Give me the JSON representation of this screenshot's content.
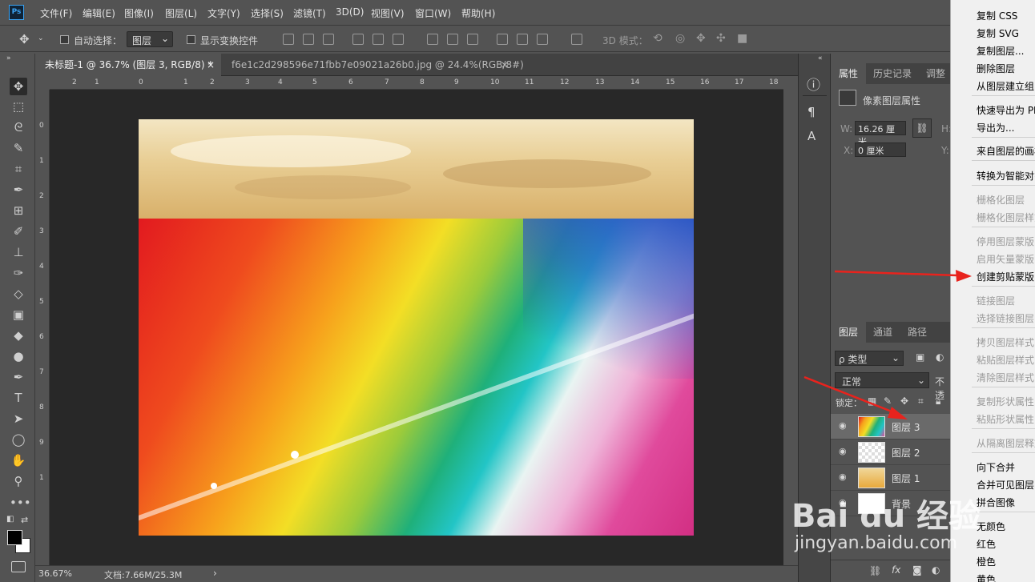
{
  "app": {
    "logo": "Ps"
  },
  "menu": [
    "文件(F)",
    "编辑(E)",
    "图像(I)",
    "图层(L)",
    "文字(Y)",
    "选择(S)",
    "滤镜(T)",
    "3D(D)",
    "视图(V)",
    "窗口(W)",
    "帮助(H)"
  ],
  "options": {
    "auto_select_label": "自动选择：",
    "auto_select_value": "图层",
    "show_transform_label": "显示变换控件",
    "mode3d_label": "3D 模式："
  },
  "tabs": [
    {
      "label": "未标题-1 @ 36.7% (图层 3, RGB/8) *",
      "close": "×"
    },
    {
      "label": "f6e1c2d298596e71fbb7e09021a26b0.jpg @ 24.4%(RGB/8#)",
      "close": "×"
    }
  ],
  "ruler_top": [
    "2",
    "1",
    "0",
    "1",
    "2",
    "3",
    "4",
    "5",
    "6",
    "7",
    "8",
    "9",
    "10",
    "11",
    "12",
    "13",
    "14",
    "15",
    "16",
    "17",
    "18"
  ],
  "ruler_left": [
    "0",
    "1",
    "2",
    "3",
    "4",
    "5",
    "6",
    "7",
    "8",
    "9",
    "1"
  ],
  "status": {
    "zoom": "36.67%",
    "doc": "文档:7.66M/25.3M",
    "arrow": "›"
  },
  "properties": {
    "tabs": [
      "属性",
      "历史记录",
      "调整"
    ],
    "title": "像素图层属性",
    "w_label": "W:",
    "w_value": "16.26 厘米",
    "h_label": "H:",
    "x_label": "X:",
    "x_value": "0 厘米",
    "y_label": "Y:"
  },
  "layers_panel": {
    "tabs": [
      "图层",
      "通道",
      "路径"
    ],
    "filter_label": "ρ 类型",
    "blend_mode": "正常",
    "opacity_label": "不透",
    "lock_label": "锁定：",
    "layers": [
      {
        "name": "图层 3"
      },
      {
        "name": "图层 2"
      },
      {
        "name": "图层 1"
      },
      {
        "name": "背景"
      }
    ],
    "fx_label": "fx"
  },
  "context_menu": [
    {
      "label": "复制 CSS",
      "enabled": true
    },
    {
      "label": "复制 SVG",
      "enabled": true
    },
    {
      "label": "复制图层...",
      "enabled": true
    },
    {
      "label": "删除图层",
      "enabled": true
    },
    {
      "label": "从图层建立组...",
      "enabled": true
    },
    {
      "label": "快速导出为 PNG",
      "enabled": true
    },
    {
      "label": "导出为...",
      "enabled": true
    },
    {
      "label": "来自图层的画板...",
      "enabled": true
    },
    {
      "label": "转换为智能对象",
      "enabled": true
    },
    {
      "label": "栅格化图层",
      "enabled": false
    },
    {
      "label": "栅格化图层样式",
      "enabled": false
    },
    {
      "label": "停用图层蒙版",
      "enabled": false
    },
    {
      "label": "启用矢量蒙版",
      "enabled": false
    },
    {
      "label": "创建剪贴蒙版",
      "enabled": true
    },
    {
      "label": "链接图层",
      "enabled": false
    },
    {
      "label": "选择链接图层",
      "enabled": false
    },
    {
      "label": "拷贝图层样式",
      "enabled": false
    },
    {
      "label": "粘贴图层样式",
      "enabled": false
    },
    {
      "label": "清除图层样式",
      "enabled": false
    },
    {
      "label": "复制形状属性",
      "enabled": false
    },
    {
      "label": "粘贴形状属性",
      "enabled": false
    },
    {
      "label": "从隔离图层释放",
      "enabled": false
    },
    {
      "label": "向下合并",
      "enabled": true
    },
    {
      "label": "合并可见图层",
      "enabled": true
    },
    {
      "label": "拼合图像",
      "enabled": true
    },
    {
      "label": "无颜色",
      "enabled": true
    },
    {
      "label": "红色",
      "enabled": true
    },
    {
      "label": "橙色",
      "enabled": true
    },
    {
      "label": "黄色",
      "enabled": true
    }
  ],
  "watermark": {
    "brand": "Bai du 经验",
    "url": "jingyan.baidu.com"
  },
  "colors": {
    "accent": "#3ba3f3",
    "arrow_red": "#e8231d",
    "panel": "#535353",
    "canvas_bg": "#282828"
  }
}
